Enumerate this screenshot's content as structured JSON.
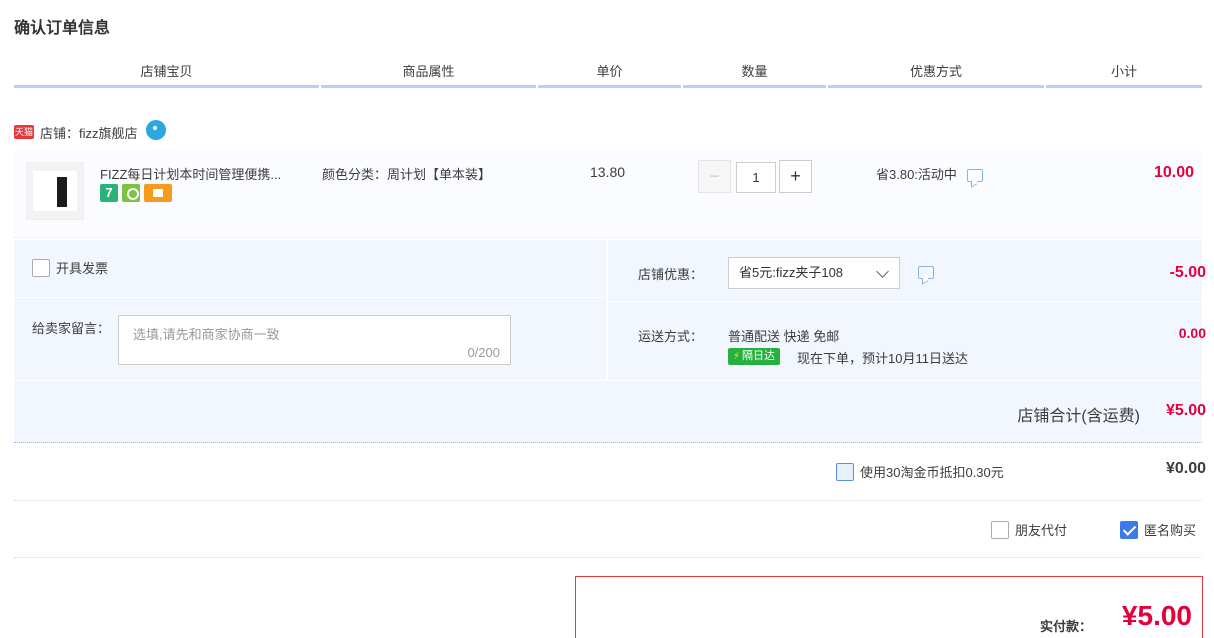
{
  "page": {
    "title": "确认订单信息"
  },
  "header": {
    "columns": [
      "店铺宝贝",
      "商品属性",
      "单价",
      "数量",
      "优惠方式",
      "小计"
    ]
  },
  "shop": {
    "badge": "天猫",
    "label": "店铺：fizz旗舰店"
  },
  "item": {
    "title": "FIZZ每日计划本时间管理便携...",
    "attribute": "颜色分类：周计划【单本装】",
    "unit_price": "13.80",
    "quantity": "1",
    "qty_minus": "−",
    "qty_plus": "+",
    "discount": "省3.80:活动中",
    "subtotal": "10.00"
  },
  "options": {
    "invoice_label": "开具发票",
    "note_label": "给卖家留言：",
    "note_placeholder": "选填,请先和商家协商一致",
    "note_count": "0/200",
    "shop_discount_label": "店铺优惠：",
    "shop_discount_selected": "省5元:fizz夹子108",
    "shop_discount_value": "-5.00",
    "shipping_label": "运送方式：",
    "shipping_method": "普通配送 快递 免邮",
    "shipping_badge": "隔日达",
    "shipping_eta": "现在下单，预计10月11日送达",
    "shipping_value": "0.00"
  },
  "shop_total": {
    "label": "店铺合计(含运费)",
    "value": "¥5.00"
  },
  "coins": {
    "label": "使用30淘金币抵扣0.30元",
    "value": "¥0.00"
  },
  "extras": {
    "friend_pay": "朋友代付",
    "anonymous": "匿名购买"
  },
  "payment": {
    "label": "实付款：",
    "value": "¥5.00"
  },
  "colors": {
    "accent_red": "#e4003a",
    "header_border": "#b2d1ff",
    "panel_bg": "#f2f7ff"
  }
}
